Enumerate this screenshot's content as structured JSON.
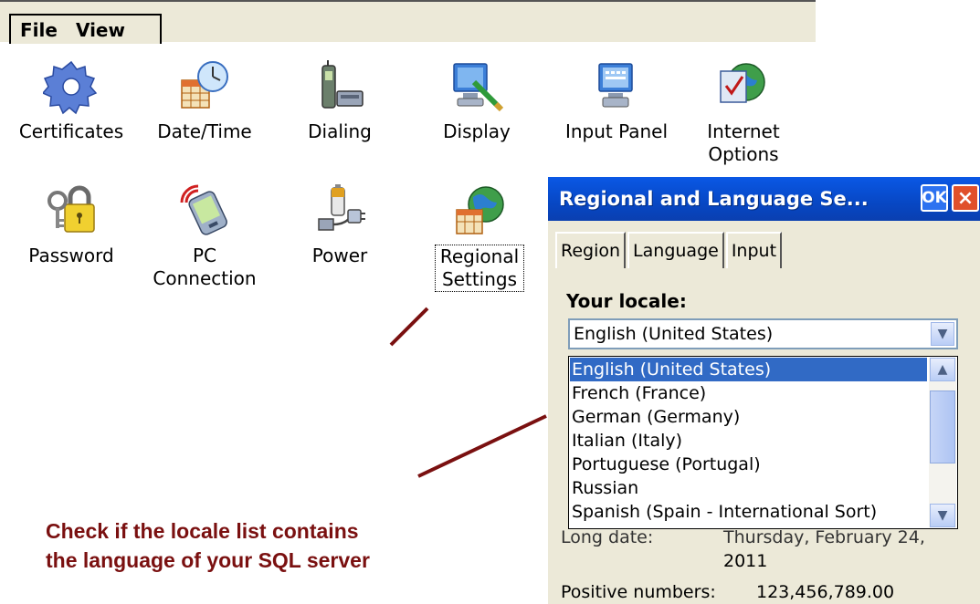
{
  "menubar": {
    "items": [
      "File",
      "View"
    ]
  },
  "control_panel": {
    "items": [
      {
        "label": "Certificates",
        "icon": "certificates-icon"
      },
      {
        "label": "Date/Time",
        "icon": "date-time-icon"
      },
      {
        "label": "Dialing",
        "icon": "dialing-icon"
      },
      {
        "label": "Display",
        "icon": "display-icon"
      },
      {
        "label": "Input Panel",
        "icon": "input-panel-icon"
      },
      {
        "label": "Internet Options",
        "icon": "internet-options-icon"
      },
      {
        "label": "Password",
        "icon": "password-icon"
      },
      {
        "label": "PC Connection",
        "icon": "pc-connection-icon"
      },
      {
        "label": "Power",
        "icon": "power-icon"
      },
      {
        "label": "Regional Settings",
        "icon": "regional-settings-icon"
      }
    ]
  },
  "dialog": {
    "title": "Regional and Language Se...",
    "ok_label": "OK",
    "close_label": "×",
    "tabs": [
      "Region",
      "Language",
      "Input"
    ],
    "active_tab": "Region",
    "locale_label": "Your locale:",
    "locale_value": "English (United States)",
    "locale_options": [
      "English (United States)",
      "French (France)",
      "German (Germany)",
      "Italian (Italy)",
      "Portuguese (Portugal)",
      "Russian",
      "Spanish (Spain - International Sort)"
    ],
    "long_date_label": "Long date:",
    "long_date_value_line1": "Thursday, February 24,",
    "long_date_value_line2": "2011",
    "positive_numbers_label": "Positive numbers:",
    "positive_numbers_value": "123,456,789.00"
  },
  "annotation": {
    "line1": "Check if the locale list contains",
    "line2": "the language of your SQL server"
  },
  "colors": {
    "title_bar": "#0747c4",
    "selection": "#316ac5",
    "annotation": "#7a1010",
    "panel_bg": "#ece9d8"
  }
}
